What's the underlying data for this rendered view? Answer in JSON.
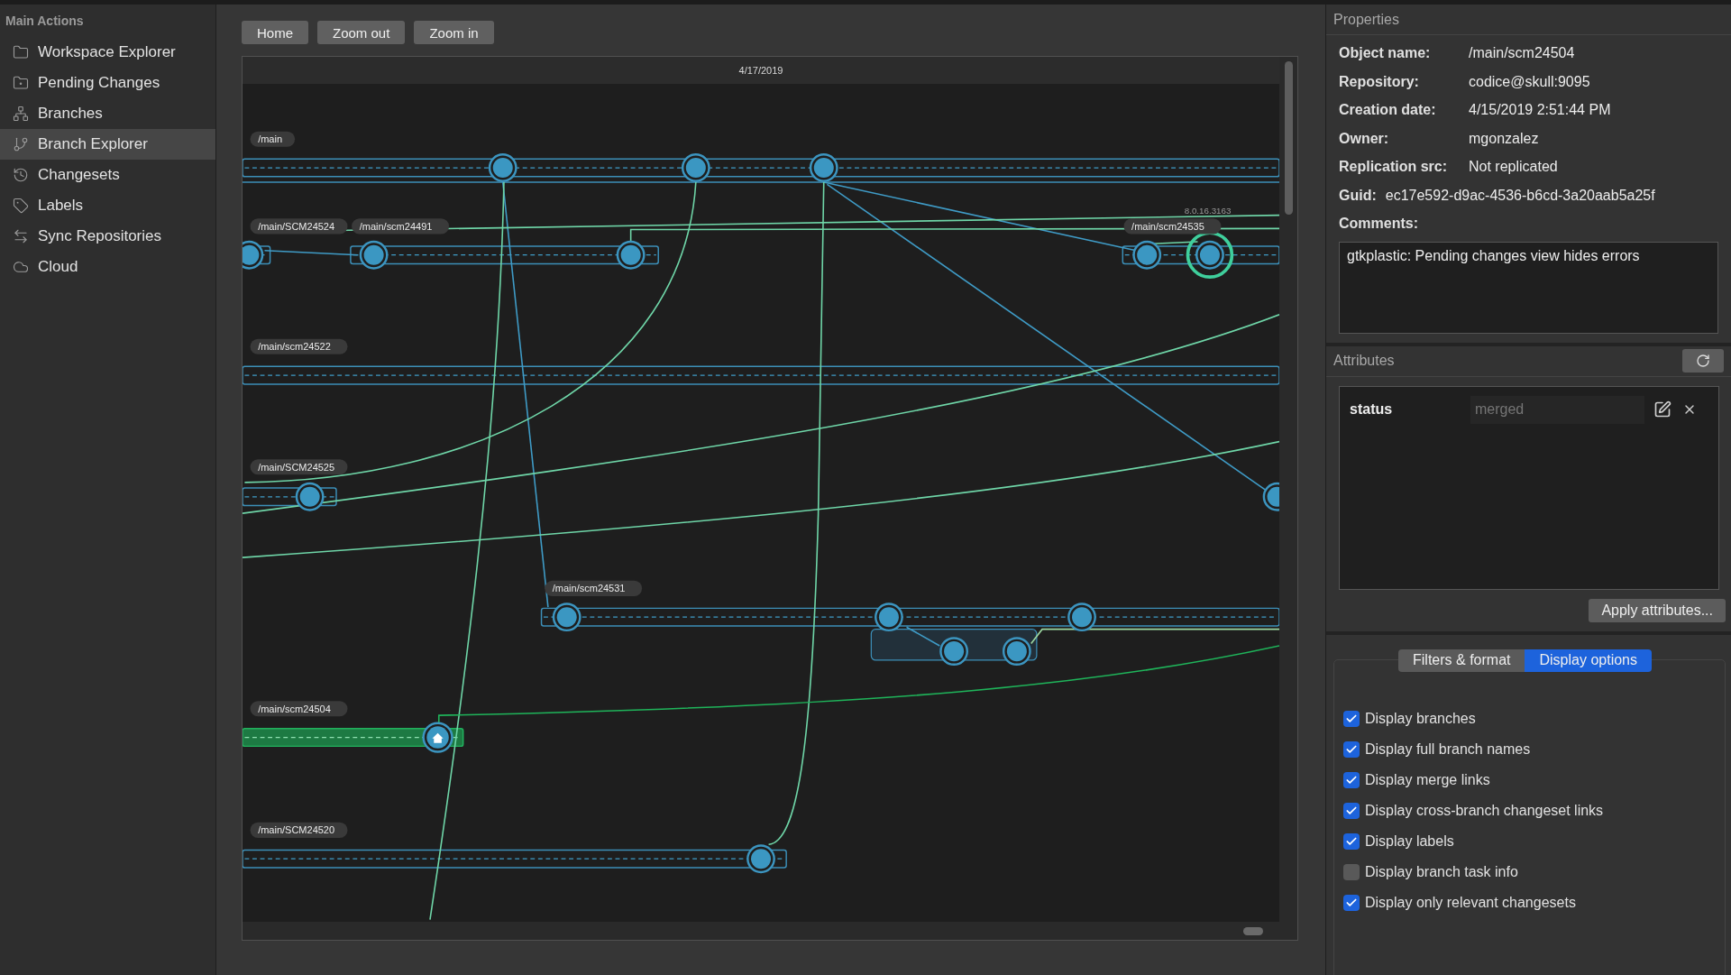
{
  "sidebar": {
    "title": "Main Actions",
    "items": [
      {
        "label": "Workspace Explorer",
        "selected": false
      },
      {
        "label": "Pending Changes",
        "selected": false
      },
      {
        "label": "Branches",
        "selected": false
      },
      {
        "label": "Branch Explorer",
        "selected": true
      },
      {
        "label": "Changesets",
        "selected": false
      },
      {
        "label": "Labels",
        "selected": false
      },
      {
        "label": "Sync Repositories",
        "selected": false
      },
      {
        "label": "Cloud",
        "selected": false
      }
    ]
  },
  "toolbar": {
    "buttons": [
      "Home",
      "Zoom out",
      "Zoom in"
    ]
  },
  "graph": {
    "date": "4/17/2019",
    "tag": "8.0.16.3163",
    "branches": [
      {
        "name": "/main",
        "selected": false
      },
      {
        "name": "/main/SCM24524",
        "selected": false
      },
      {
        "name": "/main/scm24491",
        "selected": false
      },
      {
        "name": "/main/scm24535",
        "selected": false
      },
      {
        "name": "/main/scm24522",
        "selected": false
      },
      {
        "name": "/main/SCM24525",
        "selected": false
      },
      {
        "name": "/main/scm24531",
        "selected": false
      },
      {
        "name": "/main/scm24504",
        "selected": true
      },
      {
        "name": "/main/SCM24520",
        "selected": false
      }
    ]
  },
  "properties": {
    "title": "Properties",
    "fields": [
      {
        "label": "Object name:",
        "value": "/main/scm24504"
      },
      {
        "label": "Repository:",
        "value": "codice@skull:9095"
      },
      {
        "label": "Creation date:",
        "value": "4/15/2019 2:51:44 PM"
      },
      {
        "label": "Owner:",
        "value": "mgonzalez"
      },
      {
        "label": "Replication src:",
        "value": "Not replicated"
      }
    ],
    "guid": {
      "label": "Guid:",
      "value": "ec17e592-d9ac-4536-b6cd-3a20aab5a25f"
    },
    "comments_label": "Comments:",
    "comments": "gtkplastic: Pending changes view hides errors"
  },
  "attributes": {
    "title": "Attributes",
    "items": [
      {
        "name": "status",
        "placeholder": "merged"
      }
    ],
    "apply_button": "Apply attributes..."
  },
  "options": {
    "tabs": [
      {
        "label": "Filters & format",
        "selected": false
      },
      {
        "label": "Display options",
        "selected": true
      }
    ],
    "checkboxes": [
      {
        "label": "Display branches",
        "checked": true
      },
      {
        "label": "Display full branch names",
        "checked": true
      },
      {
        "label": "Display merge links",
        "checked": true
      },
      {
        "label": "Display cross-branch changeset links",
        "checked": true
      },
      {
        "label": "Display labels",
        "checked": true
      },
      {
        "label": "Display branch task info",
        "checked": false
      },
      {
        "label": "Display only relevant changesets",
        "checked": true
      }
    ]
  }
}
